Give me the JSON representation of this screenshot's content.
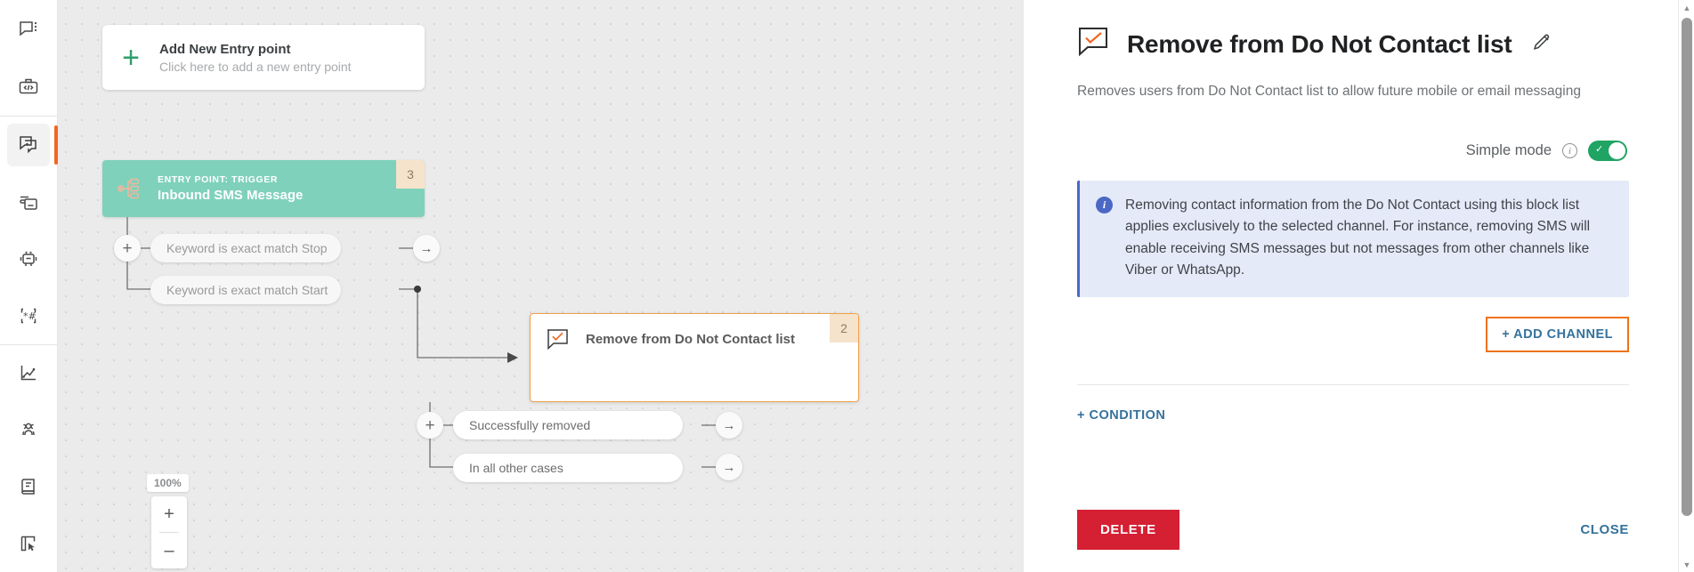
{
  "sidebar": {
    "items": [
      {
        "name": "chat-menu-icon",
        "label": "Chats"
      },
      {
        "name": "developer-kit-icon",
        "label": "Developer"
      },
      {
        "name": "flow-builder-icon",
        "label": "Flow Builder",
        "active": true
      },
      {
        "name": "templates-icon",
        "label": "Templates"
      },
      {
        "name": "chatbot-icon",
        "label": "Chatbot"
      },
      {
        "name": "ussd-icon",
        "label": "USSD"
      },
      {
        "name": "analytics-icon",
        "label": "Analytics"
      },
      {
        "name": "audience-icon",
        "label": "Audience"
      },
      {
        "name": "contacts-book-icon",
        "label": "Contacts"
      },
      {
        "name": "reports-icon",
        "label": "Reports"
      }
    ]
  },
  "canvas": {
    "add_entry": {
      "icon": "plus-icon",
      "title": "Add New Entry point",
      "subtitle": "Click here to add a new entry point"
    },
    "trigger_node": {
      "icon": "trigger-flow-icon",
      "kicker": "ENTRY POINT: TRIGGER",
      "title": "Inbound SMS Message",
      "badge": "3"
    },
    "trigger_outputs": [
      {
        "label": "Keyword is exact match Stop"
      },
      {
        "label": "Keyword is exact match Start"
      }
    ],
    "action_node": {
      "icon": "dnc-check-bubble-icon",
      "title": "Remove from Do Not Contact list",
      "badge": "2"
    },
    "action_outputs": [
      {
        "label": "Successfully removed"
      },
      {
        "label": "In all other cases"
      }
    ],
    "port_plus_label": "+",
    "port_arrow_label": "→",
    "zoom": {
      "level": "100%",
      "zoom_in_label": "+",
      "zoom_out_label": "–"
    }
  },
  "panel": {
    "icon": "dnc-check-bubble-icon",
    "title": "Remove from Do Not Contact list",
    "edit_icon": "pencil-icon",
    "description": "Removes users from Do Not Contact list to allow future mobile or email messaging",
    "simple_mode": {
      "label": "Simple mode",
      "info_icon": "info-circle-icon",
      "enabled": true,
      "toggle_glyph": "✓"
    },
    "info_box": {
      "icon": "info-filled-icon",
      "text": "Removing contact information from the Do Not Contact using this block list applies exclusively to the selected channel. For instance, removing SMS will enable receiving SMS messages but not messages from other channels like Viber or WhatsApp."
    },
    "add_channel_label": "+ ADD CHANNEL",
    "condition_label": "+ CONDITION",
    "delete_label": "DELETE",
    "close_label": "CLOSE"
  },
  "colors": {
    "accent_orange": "#ee7219",
    "link_blue": "#34729c",
    "danger_red": "#d51f33",
    "toggle_green": "#1fa463",
    "trigger_green": "#7fd1bb",
    "info_blue_bg": "#e5eaf9",
    "badge_cream": "#f6e3cb"
  }
}
